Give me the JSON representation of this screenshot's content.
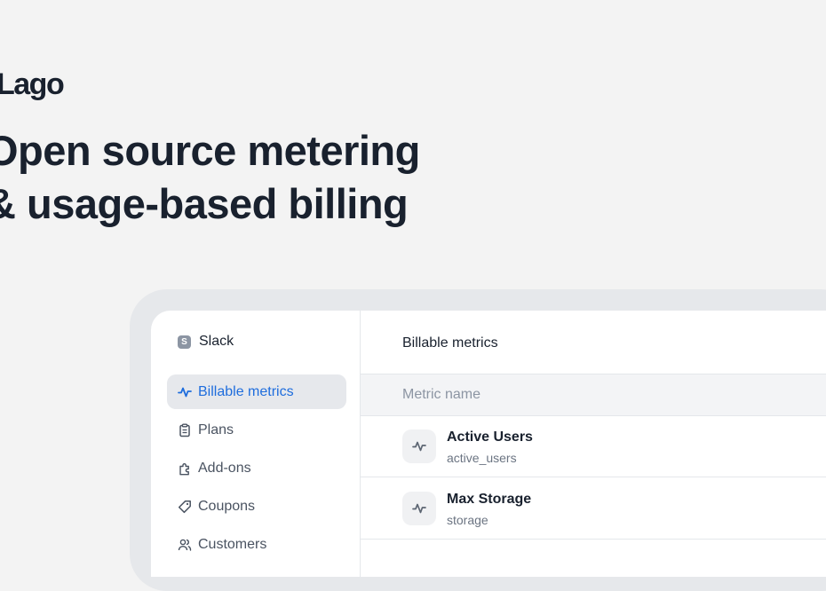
{
  "hero": {
    "logo": "Lago",
    "headline_line1": "Open source metering",
    "headline_line2": "& usage-based billing"
  },
  "sidebar": {
    "org_badge": "S",
    "org_name": "Slack",
    "items": [
      {
        "label": "Billable metrics",
        "icon": "pulse-icon",
        "active": true
      },
      {
        "label": "Plans",
        "icon": "clipboard-icon",
        "active": false
      },
      {
        "label": "Add-ons",
        "icon": "puzzle-icon",
        "active": false
      },
      {
        "label": "Coupons",
        "icon": "tag-icon",
        "active": false
      },
      {
        "label": "Customers",
        "icon": "users-icon",
        "active": false
      }
    ]
  },
  "main": {
    "title": "Billable metrics",
    "column_header": "Metric name",
    "rows": [
      {
        "name": "Active Users",
        "code": "active_users",
        "icon": "pulse-icon"
      },
      {
        "name": "Max Storage",
        "code": "storage",
        "icon": "pulse-icon"
      }
    ]
  },
  "colors": {
    "accent": "#1e6ddd",
    "background": "#f3f3f3",
    "text": "#19212e"
  }
}
